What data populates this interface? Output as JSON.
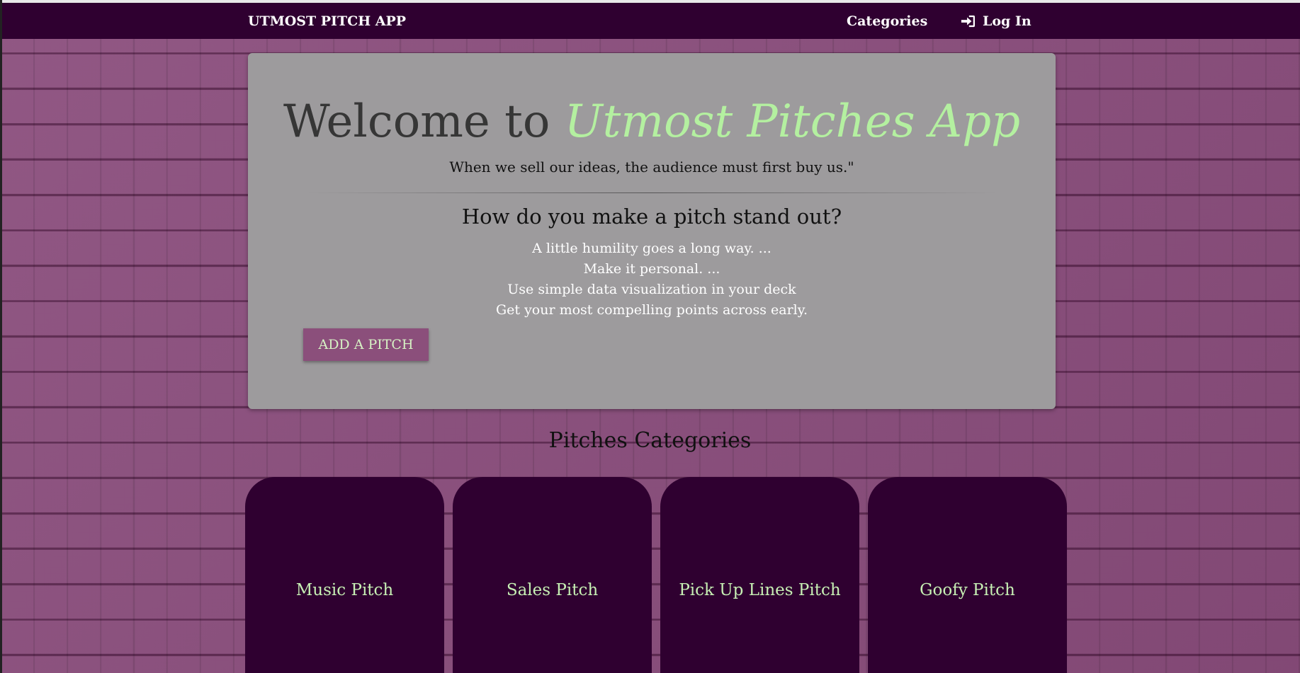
{
  "nav": {
    "brand": "UTMOST PITCH APP",
    "categories": "Categories",
    "login": "Log In"
  },
  "jumbotron": {
    "welcome_prefix": "Welcome to",
    "welcome_accent": "Utmost Pitches App",
    "quote": "When we sell our ideas, the audience must first buy us.\"",
    "question": "How do you make a pitch stand out?",
    "tips": [
      "A little humility goes a long way. ...",
      "Make it personal. ...",
      "Use simple data visualization in your deck",
      "Get your most compelling points across early."
    ],
    "add_button": "ADD A PITCH"
  },
  "categories_section": {
    "title": "Pitches Categories",
    "cards": [
      "Music Pitch",
      "Sales Pitch",
      "Pick Up Lines Pitch",
      "Goofy Pitch"
    ]
  },
  "colors": {
    "nav_bg": "#2f0030",
    "page_bg": "#8a4d7c",
    "panel_bg": "#9d9b9d",
    "accent_green": "#b4f0a0",
    "button_bg": "#8b4f7b"
  },
  "icons": {
    "login": "sign-in-icon"
  }
}
